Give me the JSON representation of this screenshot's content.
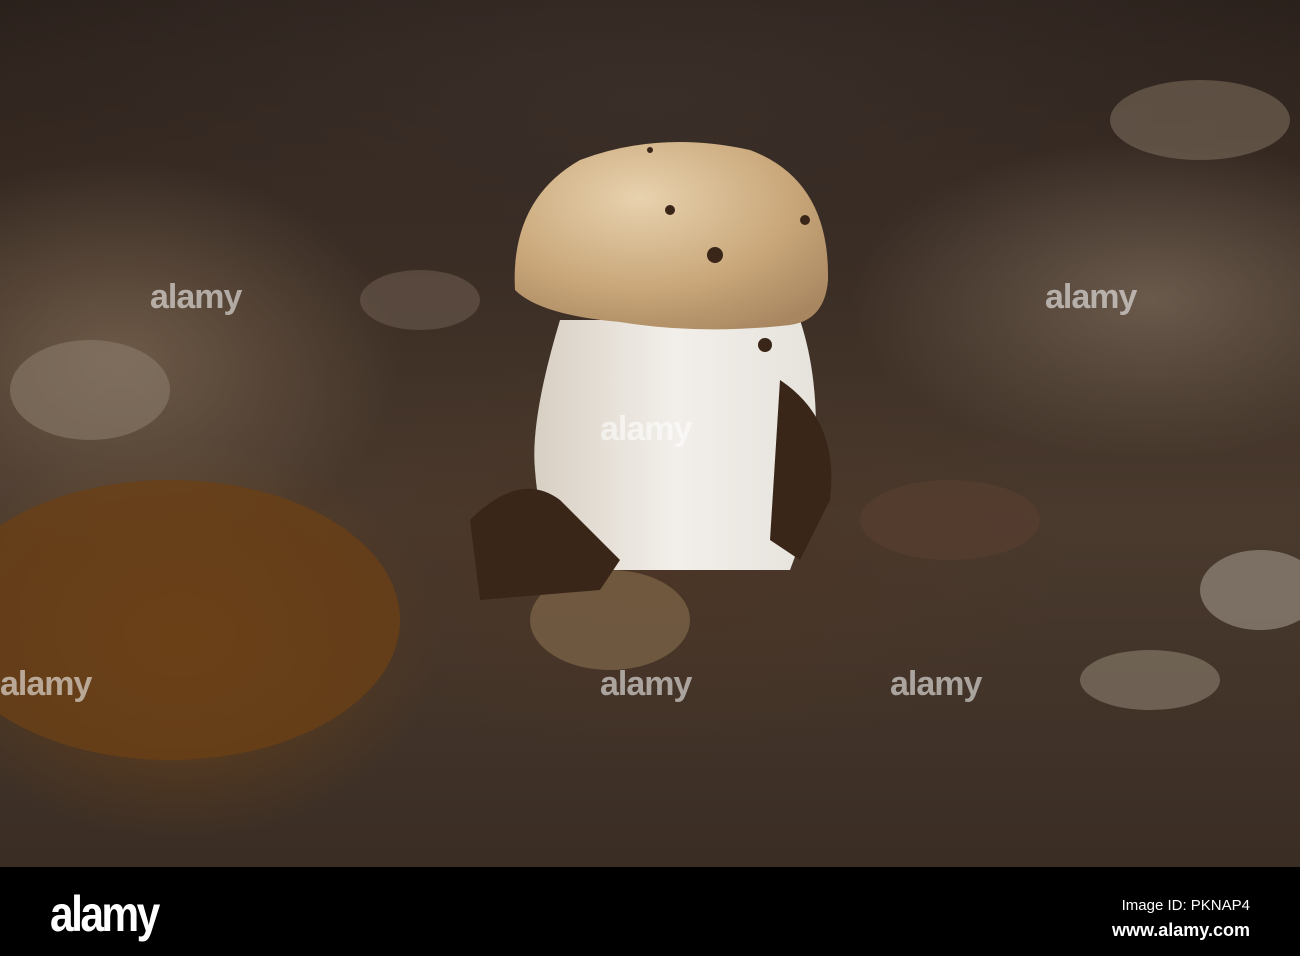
{
  "watermark": {
    "text": "alamy"
  },
  "footer": {
    "logo": "alamy",
    "image_id": "Image ID: PKNAP4",
    "website": "www.alamy.com"
  }
}
